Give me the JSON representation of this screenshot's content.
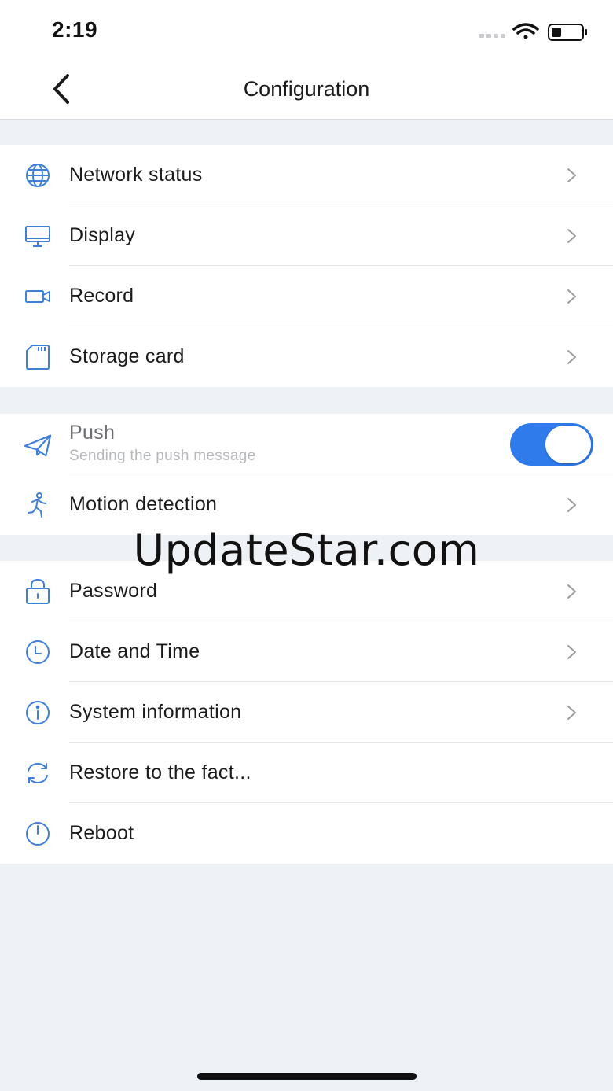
{
  "status_bar": {
    "time": "2:19"
  },
  "nav": {
    "title": "Configuration"
  },
  "colors": {
    "accent": "#2f7bec",
    "icon": "#3f7fd8",
    "background": "#eef1f6"
  },
  "group1": {
    "items": [
      {
        "label": "Network status",
        "icon": "globe-icon"
      },
      {
        "label": "Display",
        "icon": "monitor-icon"
      },
      {
        "label": "Record",
        "icon": "video-camera-icon"
      },
      {
        "label": "Storage card",
        "icon": "sd-card-icon"
      }
    ]
  },
  "group2": {
    "push": {
      "label": "Push",
      "sublabel": "Sending the push message",
      "enabled": true,
      "icon": "paper-plane-icon"
    },
    "motion": {
      "label": "Motion detection",
      "icon": "running-person-icon"
    }
  },
  "group3": {
    "items": [
      {
        "label": "Password",
        "icon": "lock-icon"
      },
      {
        "label": "Date and Time",
        "icon": "clock-icon"
      },
      {
        "label": "System information",
        "icon": "info-icon"
      },
      {
        "label": "Restore to the fact...",
        "icon": "refresh-icon"
      },
      {
        "label": "Reboot",
        "icon": "power-icon"
      }
    ]
  },
  "watermark": "UpdateStar.com"
}
